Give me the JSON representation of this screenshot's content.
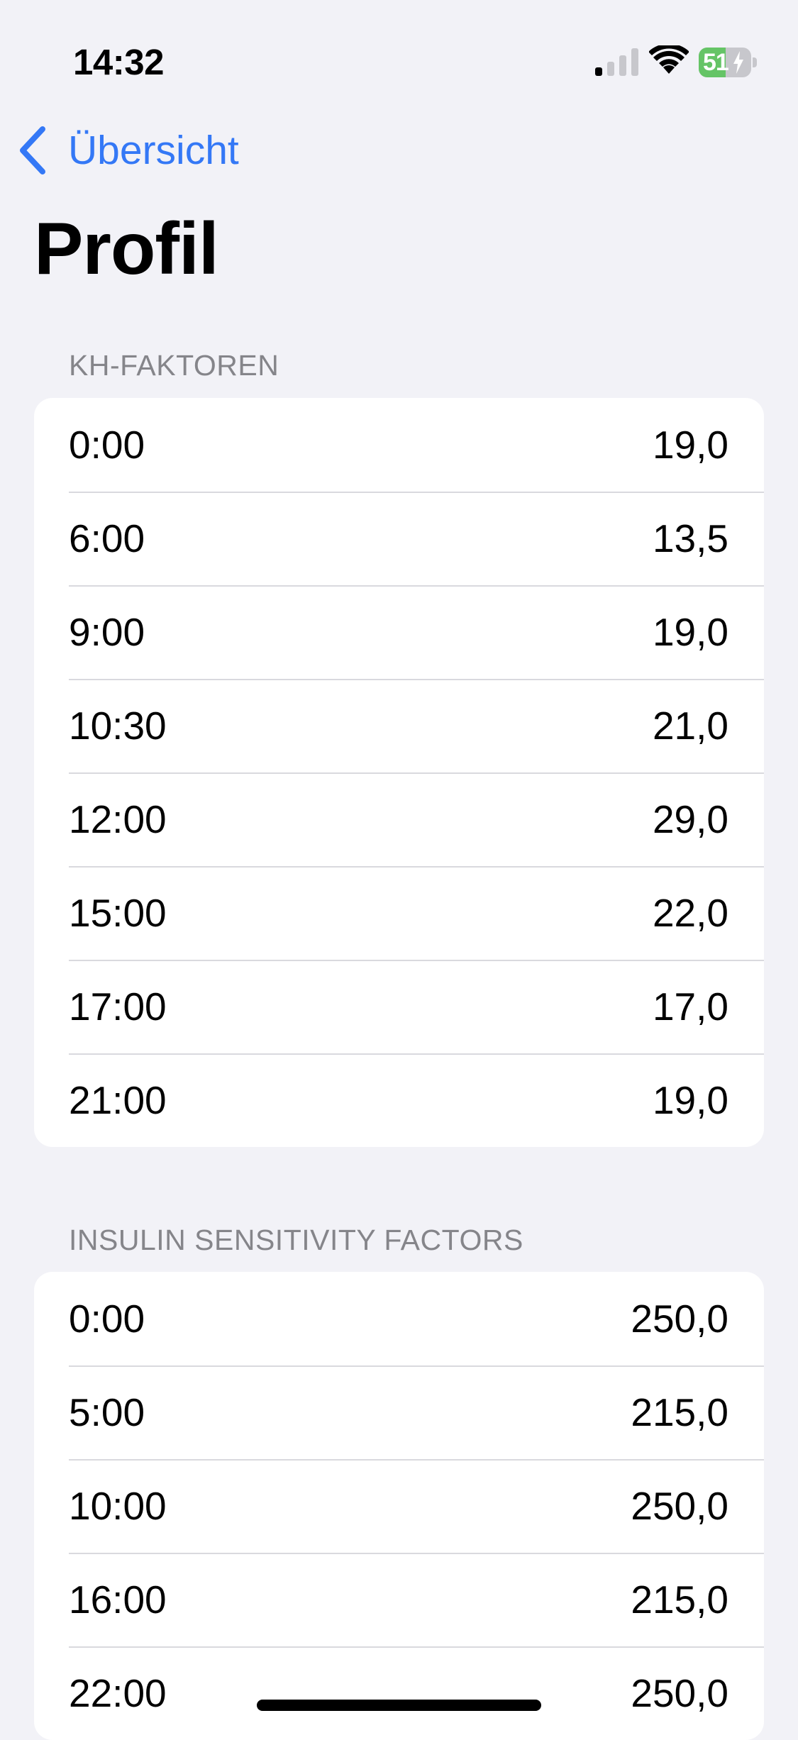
{
  "status_bar": {
    "time": "14:32",
    "battery_level": "51",
    "battery_fraction": 0.51,
    "battery_color": "#65c466",
    "signal_bars_active": 1,
    "signal_bars_total": 4,
    "icons": [
      "cellular-signal-icon",
      "wifi-icon",
      "battery-charging-icon"
    ]
  },
  "navigation": {
    "back_label": "Übersicht",
    "back_icon": "chevron-left-icon",
    "accent_color": "#3478f6"
  },
  "page": {
    "title": "Profil"
  },
  "sections": [
    {
      "header": "KH-FAKTOREN",
      "rows": [
        {
          "time": "0:00",
          "value": "19,0"
        },
        {
          "time": "6:00",
          "value": "13,5"
        },
        {
          "time": "9:00",
          "value": "19,0"
        },
        {
          "time": "10:30",
          "value": "21,0"
        },
        {
          "time": "12:00",
          "value": "29,0"
        },
        {
          "time": "15:00",
          "value": "22,0"
        },
        {
          "time": "17:00",
          "value": "17,0"
        },
        {
          "time": "21:00",
          "value": "19,0"
        }
      ]
    },
    {
      "header": "INSULIN SENSITIVITY FACTORS",
      "rows": [
        {
          "time": "0:00",
          "value": "250,0"
        },
        {
          "time": "5:00",
          "value": "215,0"
        },
        {
          "time": "10:00",
          "value": "250,0"
        },
        {
          "time": "16:00",
          "value": "215,0"
        },
        {
          "time": "22:00",
          "value": "250,0"
        }
      ]
    }
  ]
}
